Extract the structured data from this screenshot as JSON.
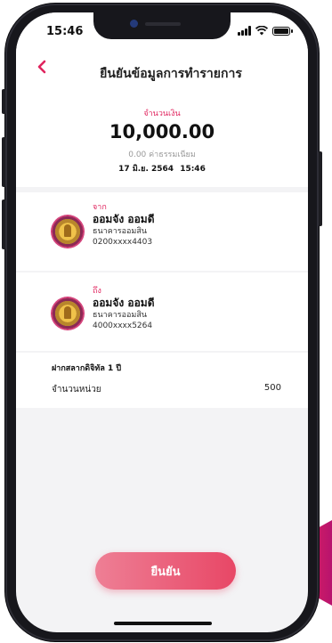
{
  "status": {
    "time": "15:46"
  },
  "header": {
    "title": "ยืนยันข้อมูลการทำรายการ"
  },
  "transaction": {
    "amount_label": "จำนวนเงิน",
    "amount": "10,000.00",
    "fee_amount": "0.00",
    "fee_label": "ค่าธรรมเนียม",
    "date": "17 มิ.ย. 2564",
    "time": "15:46"
  },
  "from": {
    "label": "จาก",
    "name": "ออมจัง ออมดี",
    "bank": "ธนาคารออมสิน",
    "account": "0200xxxx4403"
  },
  "to": {
    "label": "ถึง",
    "name": "ออมจัง ออมดี",
    "bank": "ธนาคารออมสิน",
    "account": "4000xxxx5264"
  },
  "details": {
    "title": "ฝากสลากดิจิทัล 1 ปี",
    "units_label": "จำนวนหน่วย",
    "units_value": "500"
  },
  "actions": {
    "confirm_label": "ยืนยัน"
  },
  "colors": {
    "accent": "#e0245e",
    "button_start": "#ee7f95",
    "button_end": "#e84766"
  },
  "icons": [
    "back-chevron-icon",
    "signal-icon",
    "wifi-icon",
    "battery-icon",
    "bank-logo-icon"
  ]
}
